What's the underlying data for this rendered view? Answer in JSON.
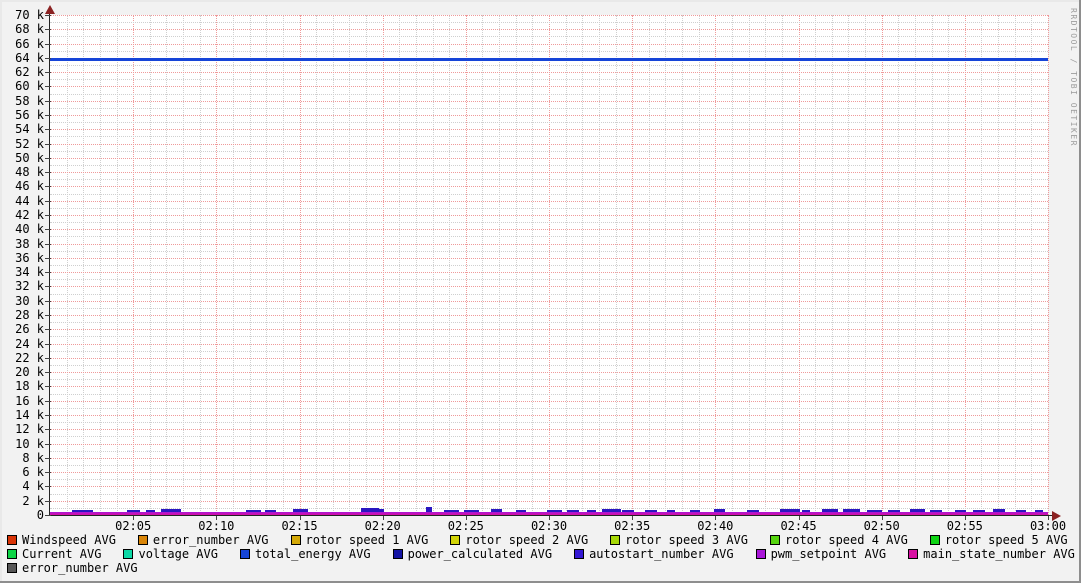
{
  "watermark": "RRDTOOL / TOBI OETIKER",
  "chart_data": {
    "type": "line",
    "title": "",
    "xlabel": "",
    "ylabel": "",
    "x_axis": {
      "unit": "time",
      "range_minutes": [
        0,
        60
      ],
      "minor_step_min": 1,
      "major_step_min": 5,
      "tick_minutes": [
        5,
        10,
        15,
        20,
        25,
        30,
        35,
        40,
        45,
        50,
        55,
        60
      ],
      "tick_labels": [
        "02:05",
        "02:10",
        "02:15",
        "02:20",
        "02:25",
        "02:30",
        "02:35",
        "02:40",
        "02:45",
        "02:50",
        "02:55",
        "03:00"
      ]
    },
    "y_axis": {
      "min": 0,
      "max": 70000,
      "major_step": 2000,
      "minor_step": 1000,
      "tick_labels_top_to_bottom": [
        "70 k",
        "68 k",
        "66 k",
        "64 k",
        "62 k",
        "60 k",
        "58 k",
        "56 k",
        "54 k",
        "52 k",
        "50 k",
        "48 k",
        "46 k",
        "44 k",
        "42 k",
        "40 k",
        "38 k",
        "36 k",
        "34 k",
        "32 k",
        "30 k",
        "28 k",
        "26 k",
        "24 k",
        "22 k",
        "20 k",
        "18 k",
        "16 k",
        "14 k",
        "12 k",
        "10 k",
        "8 k",
        "6 k",
        "4 k",
        "2 k",
        "0"
      ]
    },
    "grid": {
      "on": true,
      "major_color": "#ef9a9a",
      "minor_color": "#cfcfcf"
    },
    "colors": {
      "background": "#f2f2f2",
      "canvas": "#ffffff",
      "axis": "#222222",
      "arrow": "#8b2222",
      "watermark_text": "#9c9c9c",
      "spike": "#2a16c0",
      "baseline_top": "#a916d8",
      "baseline_bottom": "#d80fa2"
    },
    "series": [
      {
        "name": "Windspeed AVG",
        "color": "#d93407",
        "value": 0
      },
      {
        "name": "error_number AVG",
        "color": "#d98507",
        "value": 0
      },
      {
        "name": "rotor speed 1 AVG",
        "color": "#d4a907",
        "value": 0
      },
      {
        "name": "rotor speed 2 AVG",
        "color": "#d2d407",
        "value": 0
      },
      {
        "name": "rotor speed 3 AVG",
        "color": "#a7d807",
        "value": 0
      },
      {
        "name": "rotor speed 4 AVG",
        "color": "#55d40e",
        "value": 0
      },
      {
        "name": "rotor speed 5 AVG",
        "color": "#0ed414",
        "value": 0
      },
      {
        "name": "Current AVG",
        "color": "#0ed446",
        "value": 0
      },
      {
        "name": "voltage AVG",
        "color": "#0cd8a6",
        "value": 0
      },
      {
        "name": "total_energy AVG",
        "color": "#1645d8",
        "value": 63800,
        "shape": "flat horizontal line across full width"
      },
      {
        "name": "power_calculated AVG",
        "color": "#1414a4",
        "value": 0
      },
      {
        "name": "autostart_number AVG",
        "color": "#3418d4",
        "value": 0
      },
      {
        "name": "pwm_setpoint AVG",
        "color": "#a916d8",
        "value": 100,
        "shape": "thick flat line on zero baseline"
      },
      {
        "name": "main_state_number AVG",
        "color": "#d80fa2",
        "value": 100,
        "shape": "thick flat line on zero baseline"
      },
      {
        "name": "error_number AVG",
        "color": "#565656",
        "value": 0
      }
    ],
    "flat_line": {
      "series": "total_energy AVG",
      "value": 63800,
      "color": "#1645d8",
      "thickness_px": 3
    },
    "baseline": {
      "value": 0,
      "thickness_px": 3
    },
    "spikes_note": "small dark-blue bursts just above zero baseline; [start_minute, width_minutes, height_units]",
    "spikes": [
      [
        1.3,
        1.3,
        280
      ],
      [
        4.6,
        0.8,
        250
      ],
      [
        5.8,
        0.5,
        250
      ],
      [
        6.7,
        1.2,
        380
      ],
      [
        11.8,
        0.9,
        260
      ],
      [
        12.9,
        0.7,
        300
      ],
      [
        14.6,
        0.9,
        380
      ],
      [
        18.7,
        1.1,
        550
      ],
      [
        19.6,
        0.5,
        420
      ],
      [
        22.6,
        0.35,
        680
      ],
      [
        23.7,
        0.9,
        300
      ],
      [
        24.9,
        0.9,
        320
      ],
      [
        26.5,
        0.7,
        380
      ],
      [
        28.0,
        0.6,
        340
      ],
      [
        29.9,
        0.9,
        300
      ],
      [
        31.1,
        0.7,
        340
      ],
      [
        32.3,
        0.5,
        300
      ],
      [
        33.2,
        1.1,
        450
      ],
      [
        34.4,
        0.7,
        350
      ],
      [
        35.8,
        0.7,
        300
      ],
      [
        37.1,
        0.5,
        300
      ],
      [
        38.5,
        0.6,
        350
      ],
      [
        39.9,
        0.7,
        460
      ],
      [
        41.9,
        0.7,
        300
      ],
      [
        43.9,
        1.2,
        360
      ],
      [
        45.2,
        0.5,
        300
      ],
      [
        46.4,
        1.0,
        400
      ],
      [
        47.7,
        1.0,
        440
      ],
      [
        49.1,
        0.9,
        350
      ],
      [
        50.4,
        0.7,
        300
      ],
      [
        51.7,
        0.9,
        420
      ],
      [
        52.9,
        0.7,
        340
      ],
      [
        54.4,
        0.7,
        300
      ],
      [
        55.5,
        0.7,
        340
      ],
      [
        56.7,
        0.7,
        400
      ],
      [
        58.1,
        0.6,
        300
      ],
      [
        59.2,
        0.5,
        260
      ]
    ],
    "legend": {
      "position": "bottom",
      "rows": [
        [
          {
            "label": "Windspeed AVG",
            "color": "#d93407"
          },
          {
            "label": "error_number AVG",
            "color": "#d98507"
          },
          {
            "label": "rotor speed 1 AVG",
            "color": "#d4a907"
          },
          {
            "label": "rotor speed 2 AVG",
            "color": "#d2d407"
          },
          {
            "label": "rotor speed 3 AVG",
            "color": "#a7d807"
          },
          {
            "label": "rotor speed 4 AVG",
            "color": "#55d40e"
          },
          {
            "label": "rotor speed 5 AVG",
            "color": "#0ed414"
          }
        ],
        [
          {
            "label": "Current AVG",
            "color": "#0ed446"
          },
          {
            "label": "voltage AVG",
            "color": "#0cd8a6"
          },
          {
            "label": "total_energy AVG",
            "color": "#1645d8"
          },
          {
            "label": "power_calculated AVG",
            "color": "#1414a4"
          },
          {
            "label": "autostart_number AVG",
            "color": "#3418d4"
          },
          {
            "label": "pwm_setpoint AVG",
            "color": "#a916d8"
          },
          {
            "label": "main_state_number AVG",
            "color": "#d80fa2"
          }
        ],
        [
          {
            "label": "error_number AVG",
            "color": "#565656"
          }
        ]
      ]
    }
  }
}
